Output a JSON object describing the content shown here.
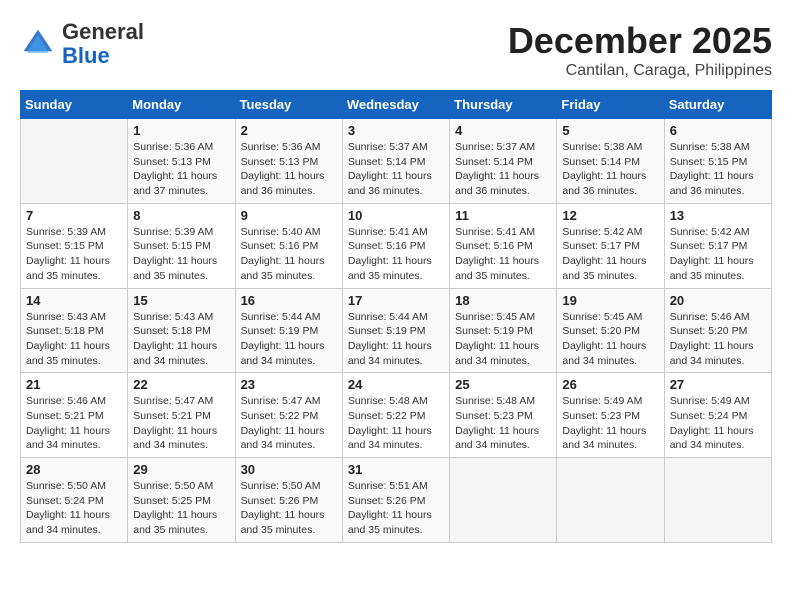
{
  "header": {
    "logo_general": "General",
    "logo_blue": "Blue",
    "month_year": "December 2025",
    "location": "Cantilan, Caraga, Philippines"
  },
  "days_of_week": [
    "Sunday",
    "Monday",
    "Tuesday",
    "Wednesday",
    "Thursday",
    "Friday",
    "Saturday"
  ],
  "weeks": [
    [
      {
        "day": "",
        "sunrise": "",
        "sunset": "",
        "daylight": ""
      },
      {
        "day": "1",
        "sunrise": "Sunrise: 5:36 AM",
        "sunset": "Sunset: 5:13 PM",
        "daylight": "Daylight: 11 hours and 37 minutes."
      },
      {
        "day": "2",
        "sunrise": "Sunrise: 5:36 AM",
        "sunset": "Sunset: 5:13 PM",
        "daylight": "Daylight: 11 hours and 36 minutes."
      },
      {
        "day": "3",
        "sunrise": "Sunrise: 5:37 AM",
        "sunset": "Sunset: 5:14 PM",
        "daylight": "Daylight: 11 hours and 36 minutes."
      },
      {
        "day": "4",
        "sunrise": "Sunrise: 5:37 AM",
        "sunset": "Sunset: 5:14 PM",
        "daylight": "Daylight: 11 hours and 36 minutes."
      },
      {
        "day": "5",
        "sunrise": "Sunrise: 5:38 AM",
        "sunset": "Sunset: 5:14 PM",
        "daylight": "Daylight: 11 hours and 36 minutes."
      },
      {
        "day": "6",
        "sunrise": "Sunrise: 5:38 AM",
        "sunset": "Sunset: 5:15 PM",
        "daylight": "Daylight: 11 hours and 36 minutes."
      }
    ],
    [
      {
        "day": "7",
        "sunrise": "Sunrise: 5:39 AM",
        "sunset": "Sunset: 5:15 PM",
        "daylight": "Daylight: 11 hours and 35 minutes."
      },
      {
        "day": "8",
        "sunrise": "Sunrise: 5:39 AM",
        "sunset": "Sunset: 5:15 PM",
        "daylight": "Daylight: 11 hours and 35 minutes."
      },
      {
        "day": "9",
        "sunrise": "Sunrise: 5:40 AM",
        "sunset": "Sunset: 5:16 PM",
        "daylight": "Daylight: 11 hours and 35 minutes."
      },
      {
        "day": "10",
        "sunrise": "Sunrise: 5:41 AM",
        "sunset": "Sunset: 5:16 PM",
        "daylight": "Daylight: 11 hours and 35 minutes."
      },
      {
        "day": "11",
        "sunrise": "Sunrise: 5:41 AM",
        "sunset": "Sunset: 5:16 PM",
        "daylight": "Daylight: 11 hours and 35 minutes."
      },
      {
        "day": "12",
        "sunrise": "Sunrise: 5:42 AM",
        "sunset": "Sunset: 5:17 PM",
        "daylight": "Daylight: 11 hours and 35 minutes."
      },
      {
        "day": "13",
        "sunrise": "Sunrise: 5:42 AM",
        "sunset": "Sunset: 5:17 PM",
        "daylight": "Daylight: 11 hours and 35 minutes."
      }
    ],
    [
      {
        "day": "14",
        "sunrise": "Sunrise: 5:43 AM",
        "sunset": "Sunset: 5:18 PM",
        "daylight": "Daylight: 11 hours and 35 minutes."
      },
      {
        "day": "15",
        "sunrise": "Sunrise: 5:43 AM",
        "sunset": "Sunset: 5:18 PM",
        "daylight": "Daylight: 11 hours and 34 minutes."
      },
      {
        "day": "16",
        "sunrise": "Sunrise: 5:44 AM",
        "sunset": "Sunset: 5:19 PM",
        "daylight": "Daylight: 11 hours and 34 minutes."
      },
      {
        "day": "17",
        "sunrise": "Sunrise: 5:44 AM",
        "sunset": "Sunset: 5:19 PM",
        "daylight": "Daylight: 11 hours and 34 minutes."
      },
      {
        "day": "18",
        "sunrise": "Sunrise: 5:45 AM",
        "sunset": "Sunset: 5:19 PM",
        "daylight": "Daylight: 11 hours and 34 minutes."
      },
      {
        "day": "19",
        "sunrise": "Sunrise: 5:45 AM",
        "sunset": "Sunset: 5:20 PM",
        "daylight": "Daylight: 11 hours and 34 minutes."
      },
      {
        "day": "20",
        "sunrise": "Sunrise: 5:46 AM",
        "sunset": "Sunset: 5:20 PM",
        "daylight": "Daylight: 11 hours and 34 minutes."
      }
    ],
    [
      {
        "day": "21",
        "sunrise": "Sunrise: 5:46 AM",
        "sunset": "Sunset: 5:21 PM",
        "daylight": "Daylight: 11 hours and 34 minutes."
      },
      {
        "day": "22",
        "sunrise": "Sunrise: 5:47 AM",
        "sunset": "Sunset: 5:21 PM",
        "daylight": "Daylight: 11 hours and 34 minutes."
      },
      {
        "day": "23",
        "sunrise": "Sunrise: 5:47 AM",
        "sunset": "Sunset: 5:22 PM",
        "daylight": "Daylight: 11 hours and 34 minutes."
      },
      {
        "day": "24",
        "sunrise": "Sunrise: 5:48 AM",
        "sunset": "Sunset: 5:22 PM",
        "daylight": "Daylight: 11 hours and 34 minutes."
      },
      {
        "day": "25",
        "sunrise": "Sunrise: 5:48 AM",
        "sunset": "Sunset: 5:23 PM",
        "daylight": "Daylight: 11 hours and 34 minutes."
      },
      {
        "day": "26",
        "sunrise": "Sunrise: 5:49 AM",
        "sunset": "Sunset: 5:23 PM",
        "daylight": "Daylight: 11 hours and 34 minutes."
      },
      {
        "day": "27",
        "sunrise": "Sunrise: 5:49 AM",
        "sunset": "Sunset: 5:24 PM",
        "daylight": "Daylight: 11 hours and 34 minutes."
      }
    ],
    [
      {
        "day": "28",
        "sunrise": "Sunrise: 5:50 AM",
        "sunset": "Sunset: 5:24 PM",
        "daylight": "Daylight: 11 hours and 34 minutes."
      },
      {
        "day": "29",
        "sunrise": "Sunrise: 5:50 AM",
        "sunset": "Sunset: 5:25 PM",
        "daylight": "Daylight: 11 hours and 35 minutes."
      },
      {
        "day": "30",
        "sunrise": "Sunrise: 5:50 AM",
        "sunset": "Sunset: 5:26 PM",
        "daylight": "Daylight: 11 hours and 35 minutes."
      },
      {
        "day": "31",
        "sunrise": "Sunrise: 5:51 AM",
        "sunset": "Sunset: 5:26 PM",
        "daylight": "Daylight: 11 hours and 35 minutes."
      },
      {
        "day": "",
        "sunrise": "",
        "sunset": "",
        "daylight": ""
      },
      {
        "day": "",
        "sunrise": "",
        "sunset": "",
        "daylight": ""
      },
      {
        "day": "",
        "sunrise": "",
        "sunset": "",
        "daylight": ""
      }
    ]
  ]
}
